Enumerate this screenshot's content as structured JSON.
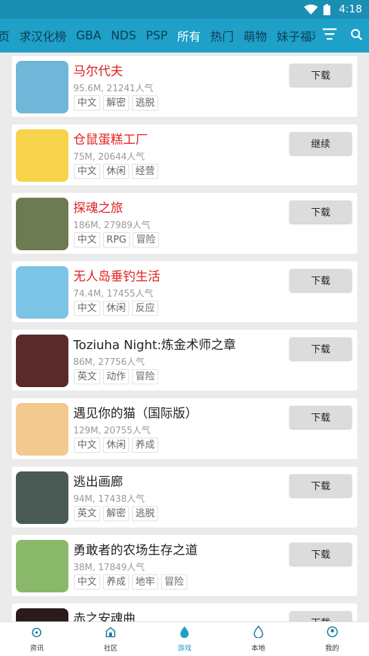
{
  "status_bar": {
    "time": "4:18"
  },
  "nav": {
    "tabs": [
      "页",
      "求汉化榜",
      "GBA",
      "NDS",
      "PSP",
      "所有",
      "热门",
      "萌物",
      "妹子福利"
    ],
    "active_tab": "所有"
  },
  "games": [
    {
      "title": "马尔代夫",
      "meta": "95.6M, 21241人气",
      "tags": [
        "中文",
        "解密",
        "逃脱"
      ],
      "button": "下载",
      "highlight": true,
      "thumb_color": "#6fb6d8"
    },
    {
      "title": "仓鼠蛋糕工厂",
      "meta": "75M, 20644人气",
      "tags": [
        "中文",
        "休闲",
        "经营"
      ],
      "button": "继续",
      "highlight": true,
      "thumb_color": "#f6d34a"
    },
    {
      "title": "探魂之旅",
      "meta": "186M, 27989人气",
      "tags": [
        "中文",
        "RPG",
        "冒险"
      ],
      "button": "下载",
      "highlight": true,
      "thumb_color": "#6e7a52"
    },
    {
      "title": "无人岛垂钓生活",
      "meta": "74.4M, 17455人气",
      "tags": [
        "中文",
        "休闲",
        "反应"
      ],
      "button": "下载",
      "highlight": true,
      "thumb_color": "#7cc4e6"
    },
    {
      "title": "Toziuha Night:炼金术师之章",
      "meta": "86M, 27756人气",
      "tags": [
        "英文",
        "动作",
        "冒险"
      ],
      "button": "下载",
      "highlight": false,
      "thumb_color": "#5a2a2a"
    },
    {
      "title": "遇见你的猫（国际版）",
      "meta": "129M, 20755人气",
      "tags": [
        "中文",
        "休闲",
        "养成"
      ],
      "button": "下载",
      "highlight": false,
      "thumb_color": "#f2c98e"
    },
    {
      "title": "逃出画廊",
      "meta": "94M, 17438人气",
      "tags": [
        "英文",
        "解密",
        "逃脱"
      ],
      "button": "下载",
      "highlight": false,
      "thumb_color": "#4a5a55"
    },
    {
      "title": "勇敢者的农场生存之道",
      "meta": "38M, 17849人气",
      "tags": [
        "中文",
        "养成",
        "地牢",
        "冒险"
      ],
      "button": "下载",
      "highlight": false,
      "thumb_color": "#8ab86a"
    },
    {
      "title": "赤之安魂曲",
      "meta": "",
      "tags": [],
      "button": "下载",
      "highlight": false,
      "thumb_color": "#2a1a1a"
    }
  ],
  "bottom_nav": [
    {
      "label": "资讯",
      "icon": "news-icon",
      "active": false
    },
    {
      "label": "社区",
      "icon": "community-icon",
      "active": false
    },
    {
      "label": "游戏",
      "icon": "game-icon",
      "active": true
    },
    {
      "label": "本地",
      "icon": "local-icon",
      "active": false
    },
    {
      "label": "我的",
      "icon": "profile-icon",
      "active": false
    }
  ],
  "colors": {
    "accent": "#1ea0c8",
    "status_bar": "#1a8fb2",
    "highlight_title": "#e02020"
  }
}
